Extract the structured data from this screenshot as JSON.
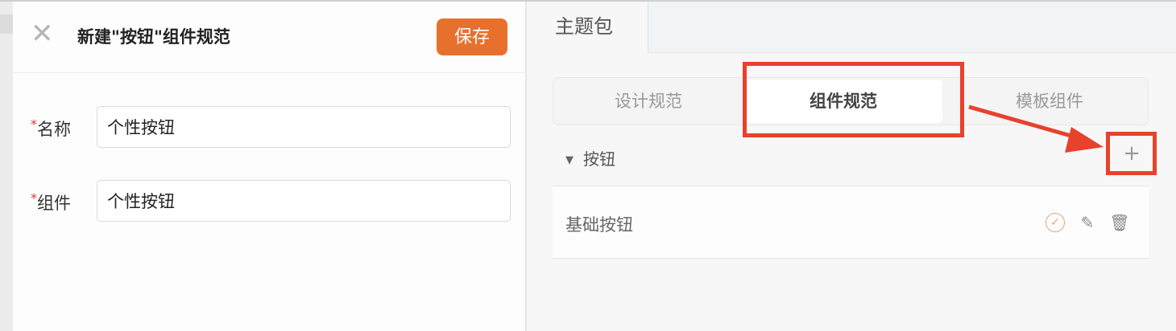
{
  "dialog": {
    "title": "新建\"按钮\"组件规范",
    "save_label": "保存",
    "close_icon": "close-icon",
    "fields": [
      {
        "label": "名称",
        "required_mark": "*",
        "value": "个性按钮"
      },
      {
        "label": "组件",
        "required_mark": "*",
        "value": "个性按钮"
      }
    ]
  },
  "right": {
    "tab": "主题包",
    "segments": [
      "设计规范",
      "组件规范",
      "模板组件"
    ],
    "active_segment": "组件规范",
    "section": {
      "title": "按钮",
      "add_symbol": "+"
    },
    "items": [
      {
        "name": "基础按钮"
      }
    ]
  },
  "colors": {
    "accent": "#e8702d",
    "annotation": "#e8412c"
  }
}
